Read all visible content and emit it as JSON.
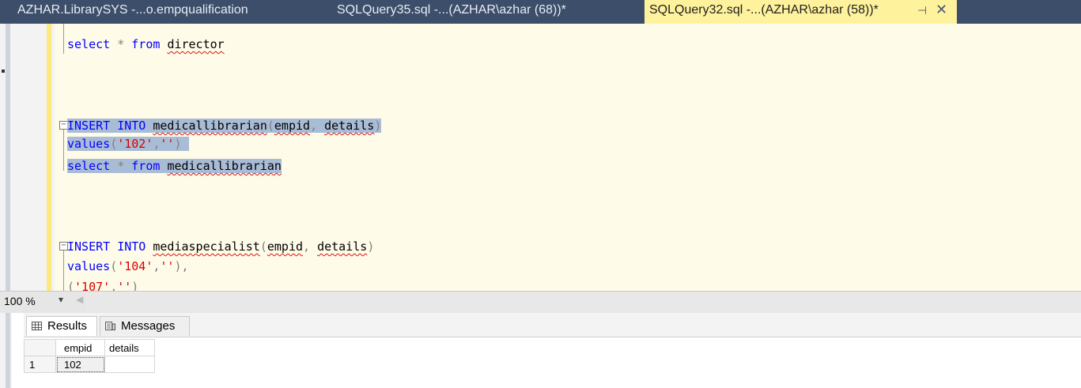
{
  "tabs": [
    {
      "label": "AZHAR.LibrarySYS -...o.empqualification"
    },
    {
      "label": "SQLQuery35.sql -...(AZHAR\\azhar (68))*"
    },
    {
      "label": "SQLQuery32.sql -...(AZHAR\\azhar (58))*",
      "active": true,
      "pin_icon": "pin-icon",
      "close_icon": "close-icon"
    }
  ],
  "editor": {
    "line1": {
      "kw1": "select",
      "op": " * ",
      "kw2": "from",
      "ident": "director"
    },
    "block1": {
      "l1": {
        "kw1": "INSERT",
        "kw2": "INTO",
        "ident": "medicallibrarian",
        "p1": "(",
        "a1": "empid",
        "c": ", ",
        "a2": "details",
        "p2": ")"
      },
      "l2": {
        "kw": "values",
        "p1": "(",
        "s1": "'102'",
        "c": ",",
        "s2": "''",
        "p2": ")"
      },
      "l3": {
        "kw1": "select",
        "op": " * ",
        "kw2": "from",
        "ident": "medicallibrarian"
      }
    },
    "block2": {
      "l1": {
        "kw1": "INSERT",
        "kw2": "INTO",
        "ident": "mediaspecialist",
        "p1": "(",
        "a1": "empid",
        "c": ", ",
        "a2": "details",
        "p2": ")"
      },
      "l2": {
        "kw": "values",
        "p1": "(",
        "s1": "'104'",
        "c": ",",
        "s2": "''",
        "p2": "),"
      },
      "l3": {
        "p1": "(",
        "s1": "'107'",
        "c": ",",
        "s2": "''",
        "p2": ")"
      }
    }
  },
  "zoom": {
    "value": "100 %"
  },
  "results": {
    "tabs": [
      {
        "label": "Results",
        "icon": "grid-icon"
      },
      {
        "label": "Messages",
        "icon": "messages-icon"
      }
    ],
    "columns": [
      "empid",
      "details"
    ],
    "rows": [
      {
        "num": "1",
        "empid": "102",
        "details": ""
      }
    ]
  },
  "colors": {
    "tabstrip": "#3c4e6a",
    "active_tab": "#fff29d",
    "editor_bg": "#fefbe8",
    "keyword": "#0000ff",
    "string": "#d60000",
    "selection": "#a9bcd6"
  }
}
